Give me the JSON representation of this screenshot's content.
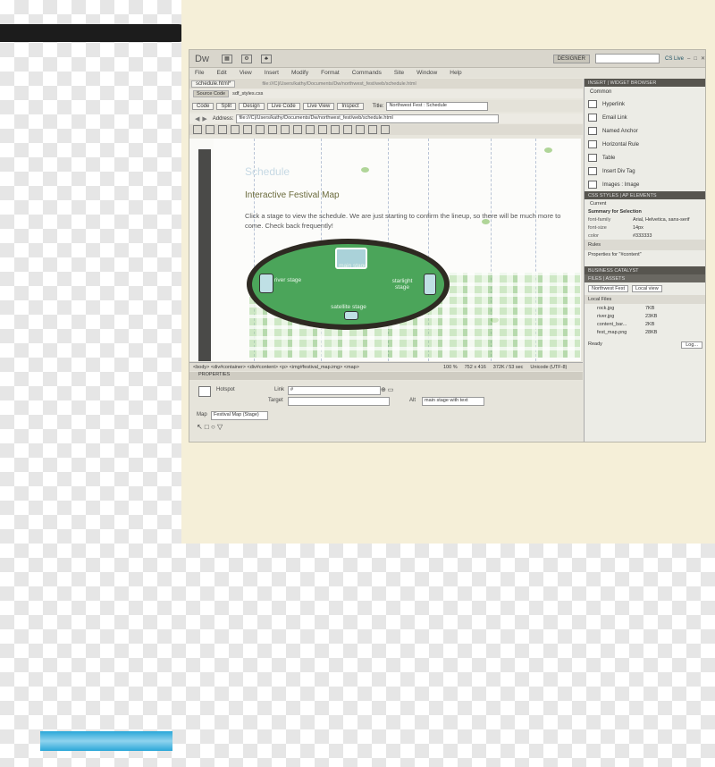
{
  "app": {
    "logo": "Dw",
    "workspace": "DESIGNER",
    "cs_live": "CS Live",
    "window_controls": [
      "–",
      "□",
      "✕"
    ]
  },
  "menu": [
    "File",
    "Edit",
    "View",
    "Insert",
    "Modify",
    "Format",
    "Commands",
    "Site",
    "Window",
    "Help"
  ],
  "document": {
    "tab": "schedule.html*",
    "related_label": "Source Code",
    "related_file": "sdf_styles.css",
    "views": [
      "Code",
      "Split",
      "Design",
      "Live Code",
      "Live View",
      "Inspect"
    ],
    "title_label": "Title:",
    "title_value": "Northwest Fest : Schedule",
    "address_label": "Address:",
    "address_value": "file:///C|/Users/kathy/Documents/Dw/northwest_fest/web/schedule.html"
  },
  "page": {
    "heading": "Schedule",
    "subheading": "Interactive Festival Map",
    "intro": "Click a stage to view the schedule. We are just starting to confirm the lineup, so there will be much more to come. Check back frequently!",
    "stages": {
      "main": "main stage",
      "river": "river stage",
      "starlight": "starlight stage",
      "satellite": "satellite stage"
    }
  },
  "status_bar": {
    "tags": "<body> <div#container> <div#content> <p> <img#festival_map.img> <map>",
    "zoom": "100 %",
    "size": "752 x 416",
    "file": "372K / 53 sec",
    "encoding": "Unicode (UTF-8)"
  },
  "properties": {
    "header": "PROPERTIES",
    "hotspot_label": "Hotspot",
    "link_label": "Link",
    "link_value": "#",
    "target_label": "Target",
    "alt_label": "Alt",
    "alt_value": "main stage with text",
    "map_label": "Map",
    "map_value": "Festival Map (Stage)"
  },
  "insert_panel": {
    "header": "INSERT | WIDGET BROWSER",
    "category": "Common",
    "items": [
      "Hyperlink",
      "Email Link",
      "Named Anchor",
      "Horizontal Rule",
      "Table",
      "Insert Div Tag",
      "Images : Image"
    ]
  },
  "css_panel": {
    "tabs": "CSS STYLES | AP ELEMENTS",
    "mode": "Current",
    "summary": "Summary for Selection",
    "rows": [
      {
        "prop": "font-family",
        "value": "Arial, Helvetica, sans-serif"
      },
      {
        "prop": "font-size",
        "value": "14px"
      },
      {
        "prop": "color",
        "value": "#333333"
      }
    ],
    "rules_label": "Rules",
    "properties_for": "Properties for \"#content\""
  },
  "files_panel": {
    "header": "BUSINESS CATALYST",
    "tabs": "FILES | ASSETS",
    "site": "Northwest Fest",
    "view": "Local view",
    "column": "Local Files",
    "files": [
      {
        "name": "rock.jpg",
        "size": "7KB"
      },
      {
        "name": "river.jpg",
        "size": "23KB"
      },
      {
        "name": "content_bar...",
        "size": "2KB"
      },
      {
        "name": "fest_map.png",
        "size": "28KB"
      }
    ],
    "ready": "Ready",
    "log": "Log..."
  }
}
